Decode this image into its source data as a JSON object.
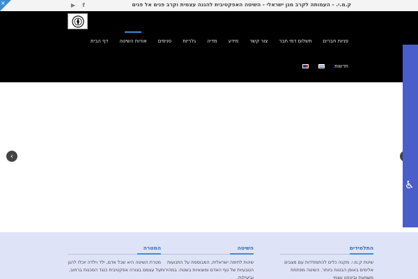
{
  "topbar": {
    "tagline": "ק.מ.י. - העמותה לקרב מגן ישראלי - השיטה האפקטיבית להגנה עצמית וקרב פנים אל פנים",
    "social": [
      {
        "icon": "facebook-icon",
        "glyph": "f"
      },
      {
        "icon": "youtube-icon",
        "glyph": "▶"
      }
    ],
    "close_glyph": "×"
  },
  "nav": {
    "items": [
      {
        "label": "דף הבית",
        "active": false
      },
      {
        "label": "אודות השיטה",
        "active": true
      },
      {
        "label": "סניפים",
        "active": false
      },
      {
        "label": "גלריות",
        "active": false
      },
      {
        "label": "מדיה",
        "active": false
      },
      {
        "label": "מידע",
        "active": false
      },
      {
        "label": "צור קשר",
        "active": false
      },
      {
        "label": "תשלום דמי חבר",
        "active": false
      },
      {
        "label": "פניות חברים",
        "active": false
      }
    ],
    "row2": {
      "news_label": "חדשות",
      "languages": [
        "he",
        "en"
      ]
    }
  },
  "slider": {
    "prev_glyph": "‹"
  },
  "accessibility": {
    "icon": "wheelchair-icon",
    "glyph": "♿"
  },
  "columns": [
    {
      "title": "התלמידים",
      "text": "שיטת ק.מ.י. מקנה כלים להתמודדות עם מצבים אלימים באופן הבטוח ביותר. השיטה מפתחת משמעת וביטחון עצמי"
    },
    {
      "title": "השיטה",
      "text": "שיטת לחימה ישראלית, המבוססת על התנועות הטבעיות של גוף האדם ומוצאיות בשטח. במהירות וביעילות."
    },
    {
      "title": "המטרה",
      "text": "מטרת השיטה היא שכל אדם, ילד וילדה יוכלו להגן על עצמם בצורה אפקטיבית כנגד הסכנות ברחוב."
    }
  ],
  "colors": {
    "header_bg": "#000000",
    "accent": "#3b8dd6",
    "info_bg": "#dfe3f7",
    "access_tab": "#4a5ec9"
  }
}
